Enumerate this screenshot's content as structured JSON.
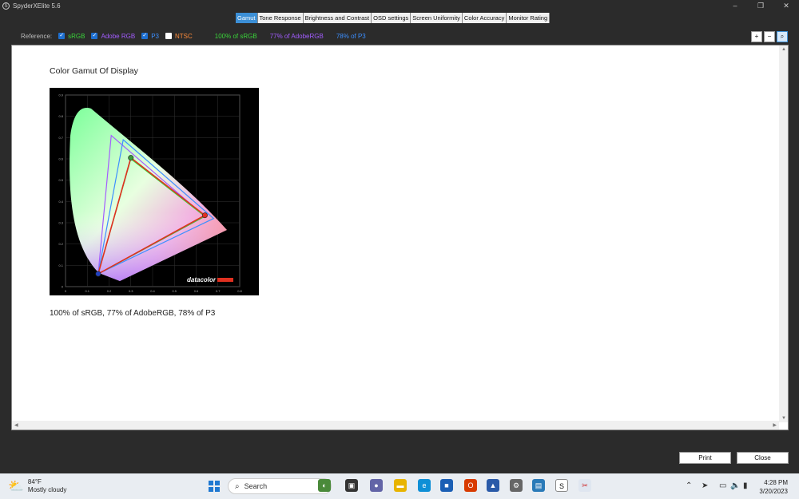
{
  "window": {
    "title": "SpyderXElite 5.6",
    "app_icon": "S",
    "min": "–",
    "max": "❐",
    "close": "✕"
  },
  "tabs": [
    "Gamut",
    "Tone Response",
    "Brightness and Contrast",
    "OSD settings",
    "Screen Uniformity",
    "Color Accuracy",
    "Monitor Rating"
  ],
  "active_tab": "Gamut",
  "reference": {
    "label": "Reference:",
    "srgb": "sRGB",
    "adobe": "Adobe RGB",
    "p3": "P3",
    "ntsc": "NTSC",
    "srgb_checked": true,
    "adobe_checked": true,
    "p3_checked": true,
    "ntsc_checked": false,
    "pct_srgb": "100% of sRGB",
    "pct_adobe": "77% of AdobeRGB",
    "pct_p3": "78% of P3",
    "colors": {
      "srgb": "#3ad43a",
      "adobe": "#a35cff",
      "p3": "#3c8fff",
      "ntsc": "#ff8c3a"
    }
  },
  "zoom": {
    "in": "+",
    "out": "−",
    "fit": "⌕"
  },
  "content": {
    "title": "Color Gamut Of Display",
    "result": "100% of sRGB, 77% of AdobeRGB, 78% of P3"
  },
  "chart_data": {
    "type": "scatter",
    "title": "",
    "x_ticks": [
      "0",
      "0.1",
      "0.2",
      "0.3",
      "0.4",
      "0.5",
      "0.6",
      "0.7",
      "0.8"
    ],
    "y_ticks": [
      "0.9",
      "0.8",
      "0.7",
      "0.6",
      "0.5",
      "0.4",
      "0.3",
      "0.2",
      "0.1",
      "0"
    ],
    "xlim": [
      0,
      0.8
    ],
    "ylim": [
      0,
      0.9
    ],
    "brand": "datacolor",
    "series": [
      {
        "name": "AdobeRGB",
        "color": "#a35cff",
        "points": [
          [
            0.64,
            0.33
          ],
          [
            0.21,
            0.71
          ],
          [
            0.15,
            0.06
          ]
        ]
      },
      {
        "name": "P3",
        "color": "#3c8fff",
        "points": [
          [
            0.68,
            0.32
          ],
          [
            0.265,
            0.69
          ],
          [
            0.15,
            0.06
          ]
        ]
      },
      {
        "name": "sRGB",
        "color": "#3ad43a",
        "points": [
          [
            0.64,
            0.33
          ],
          [
            0.3,
            0.6
          ],
          [
            0.15,
            0.06
          ]
        ]
      },
      {
        "name": "Display",
        "color": "#e03020",
        "points": [
          [
            0.64,
            0.335
          ],
          [
            0.3,
            0.605
          ],
          [
            0.15,
            0.06
          ]
        ]
      }
    ]
  },
  "buttons": {
    "print": "Print",
    "close": "Close"
  },
  "taskbar": {
    "temp": "84°F",
    "weather": "Mostly cloudy",
    "search": "Search",
    "time": "4:28 PM",
    "date": "3/20/2023"
  }
}
